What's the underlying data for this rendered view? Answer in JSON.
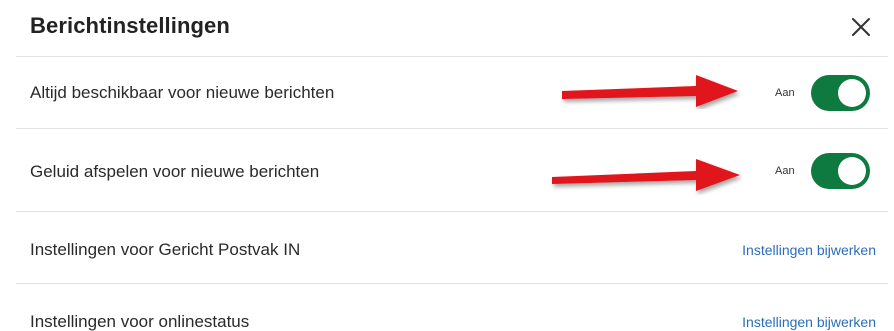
{
  "dialog": {
    "title": "Berichtinstellingen",
    "close_icon": "close-icon"
  },
  "settings": [
    {
      "label": "Altijd beschikbaar voor nieuwe berichten",
      "type": "toggle",
      "status": "Aan",
      "on": true
    },
    {
      "label": "Geluid afspelen voor nieuwe berichten",
      "type": "toggle",
      "status": "Aan",
      "on": true
    },
    {
      "label": "Instellingen voor Gericht Postvak IN",
      "type": "link",
      "action": "Instellingen bijwerken"
    },
    {
      "label": "Instellingen voor onlinestatus",
      "type": "link",
      "action": "Instellingen bijwerken"
    }
  ],
  "colors": {
    "toggle_on": "#0f7a3f",
    "link": "#2a6ebb",
    "annotation_arrow": "#e0121d"
  },
  "annotations": {
    "arrow_icon": "red-arrow-icon"
  }
}
